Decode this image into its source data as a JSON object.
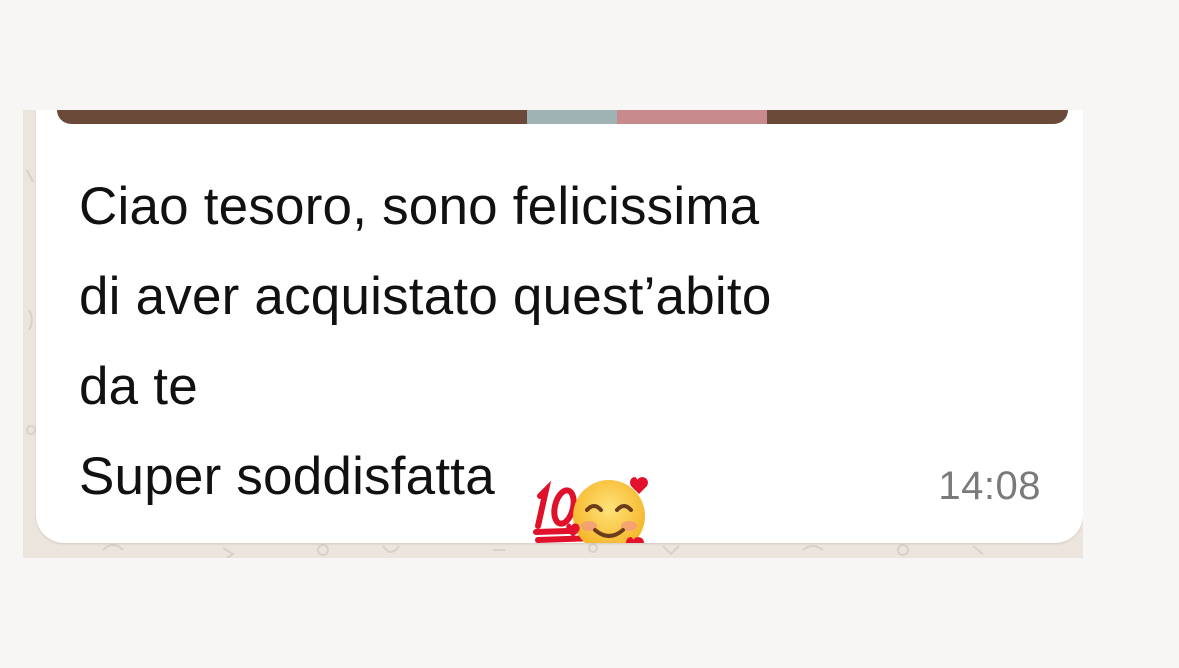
{
  "message": {
    "lines": [
      "Ciao tesoro, sono felicissima",
      "di aver acquistato quest’abito",
      "da te",
      "Super soddisfatta"
    ],
    "emojis": [
      "hundred-points-icon",
      "smiling-face-with-hearts-icon"
    ],
    "timestamp": "14:08"
  },
  "colors": {
    "page_background": "#f7f6f5",
    "chat_background": "#ece5dd",
    "bubble": "#ffffff",
    "text": "#111111",
    "timestamp": "#7a7a7a"
  }
}
